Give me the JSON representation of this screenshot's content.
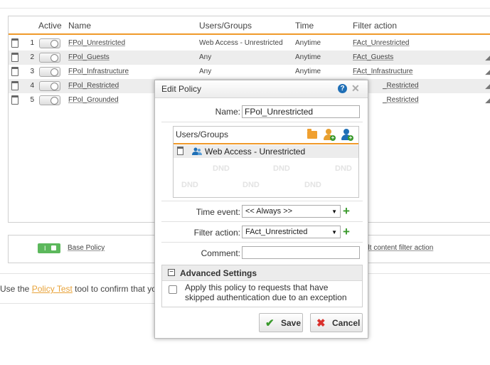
{
  "table": {
    "headers": {
      "active": "Active",
      "name": "Name",
      "users": "Users/Groups",
      "time": "Time",
      "filter": "Filter action"
    },
    "rows": [
      {
        "num": "1",
        "name": "FPol_Unrestricted",
        "users": "Web Access - Unrestricted",
        "time": "Anytime",
        "filter": "FAct_Unrestricted"
      },
      {
        "num": "2",
        "name": "FPol_Guests",
        "users": "Any",
        "time": "Anytime",
        "filter": "FAct_Guests"
      },
      {
        "num": "3",
        "name": "FPol_Infrastructure",
        "users": "Any",
        "time": "Anytime",
        "filter": "FAct_Infrastructure"
      },
      {
        "num": "4",
        "name": "FPol_Restricted",
        "users": "",
        "time": "",
        "filter": "_Restricted"
      },
      {
        "num": "5",
        "name": "FPol_Grounded",
        "users": "",
        "time": "",
        "filter": "_Restricted"
      }
    ]
  },
  "base": {
    "label": "Base Policy",
    "default_link": "ult content filter action"
  },
  "tip": {
    "prefix": "Use the ",
    "link": "Policy Test",
    "suffix": " tool to confirm that yo"
  },
  "dialog": {
    "title": "Edit Policy",
    "name_label": "Name:",
    "name_value": "FPol_Unrestricted",
    "users_title": "Users/Groups",
    "users_item": "Web Access - Unrestricted",
    "dnd": "DND",
    "time_label": "Time event:",
    "time_value": "<< Always >>",
    "filter_label": "Filter action:",
    "filter_value": "FAct_Unrestricted",
    "comment_label": "Comment:",
    "comment_value": "",
    "advanced_title": "Advanced Settings",
    "advanced_option": "Apply this policy to requests that have skipped authentication due to an exception",
    "save": "Save",
    "cancel": "Cancel"
  },
  "colors": {
    "accent": "#f09a2a",
    "add_green": "#3a9a2c",
    "help_blue": "#1f6fb6",
    "cancel_red": "#d9302c"
  }
}
